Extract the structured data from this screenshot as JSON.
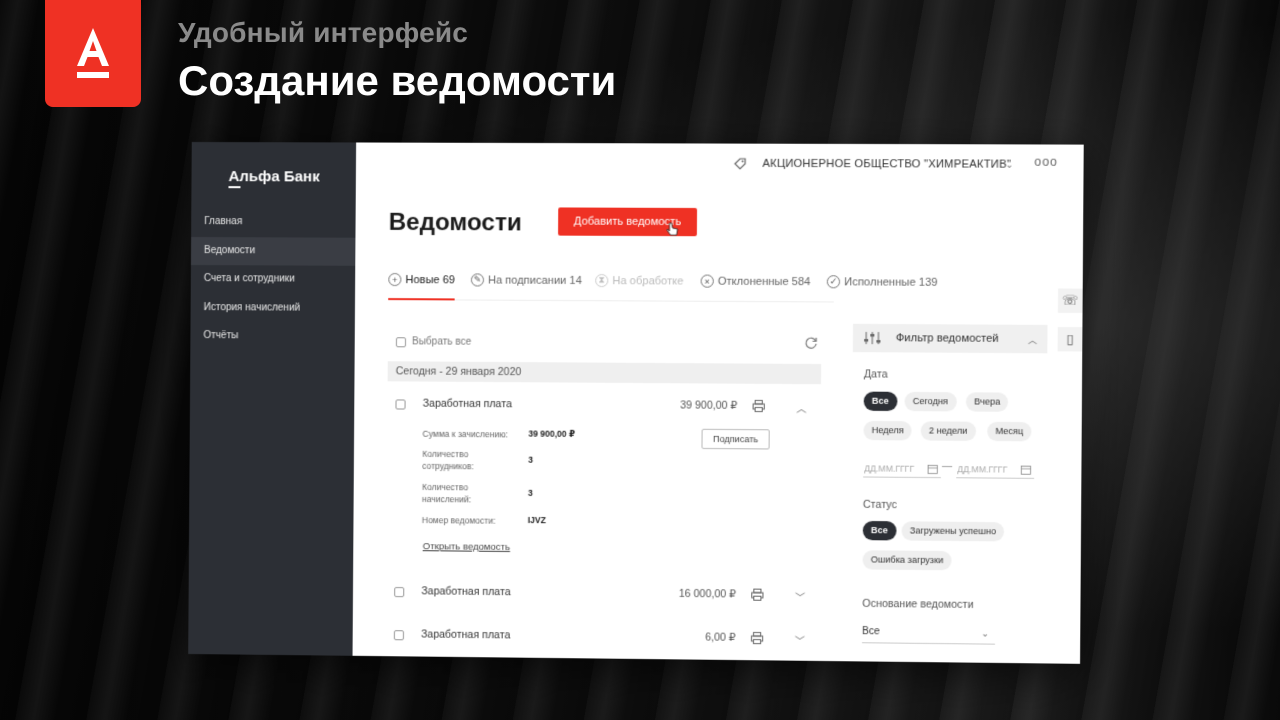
{
  "headline": {
    "subtitle": "Удобный интерфейс",
    "title": "Создание ведомости"
  },
  "colors": {
    "brand_red": "#ef3124",
    "sidebar": "#2c2f35"
  },
  "sidebar": {
    "brand": "Альфа Банк",
    "items": [
      {
        "label": "Главная"
      },
      {
        "label": "Ведомости"
      },
      {
        "label": "Счета и сотрудники"
      },
      {
        "label": "История начислений"
      },
      {
        "label": "Отчёты"
      }
    ]
  },
  "topbar": {
    "company": "АКЦИОНЕРНОЕ ОБЩЕСТВО \"ХИМРЕАКТИВ\"",
    "chevron": "⌄",
    "more": "ooo"
  },
  "page": {
    "title": "Ведомости",
    "add_button": "Добавить ведомость"
  },
  "tabs": [
    {
      "label": "Новые 69",
      "icon": "+"
    },
    {
      "label": "На подписании 14",
      "icon": "✎"
    },
    {
      "label": "На обработке",
      "icon": "⧗"
    },
    {
      "label": "Отклоненные 584",
      "icon": "×"
    },
    {
      "label": "Исполненные 139",
      "icon": "✓"
    }
  ],
  "list": {
    "select_all": "Выбрать все",
    "date_group": "Сегодня - 29 января 2020",
    "rows": [
      {
        "name": "Заработная плата",
        "amount": "39 900,00 ₽",
        "chevron": "︿"
      },
      {
        "name": "Заработная плата",
        "amount": "16 000,00 ₽",
        "chevron": "﹀"
      },
      {
        "name": "Заработная плата",
        "amount": "6,00 ₽",
        "chevron": "﹀"
      }
    ],
    "detail": {
      "sum_label": "Сумма к зачислению:",
      "sum_value": "39 900,00 ₽",
      "employees_label": "Количество сотрудников:",
      "employees_value": "3",
      "accruals_label": "Количество начислений:",
      "accruals_value": "3",
      "number_label": "Номер ведомости:",
      "number_value": "IJVZ",
      "sign_button": "Подписать",
      "open_link": "Открыть ведомость"
    }
  },
  "filter": {
    "title": "Фильтр ведомостей",
    "date_label": "Дата",
    "date_pills": [
      "Все",
      "Сегодня",
      "Вчера",
      "Неделя",
      "2 недели",
      "Месяц"
    ],
    "date_from_placeholder": "ДД.ММ.ГГГГ",
    "date_to_placeholder": "ДД.ММ.ГГГГ",
    "date_dash": "—",
    "status_label": "Статус",
    "status_pills": [
      "Все",
      "Загружены успешно",
      "Ошибка загрузки"
    ],
    "base_label": "Основание ведомости",
    "base_value": "Все"
  },
  "side_tools": [
    "phone-icon",
    "book-icon"
  ]
}
